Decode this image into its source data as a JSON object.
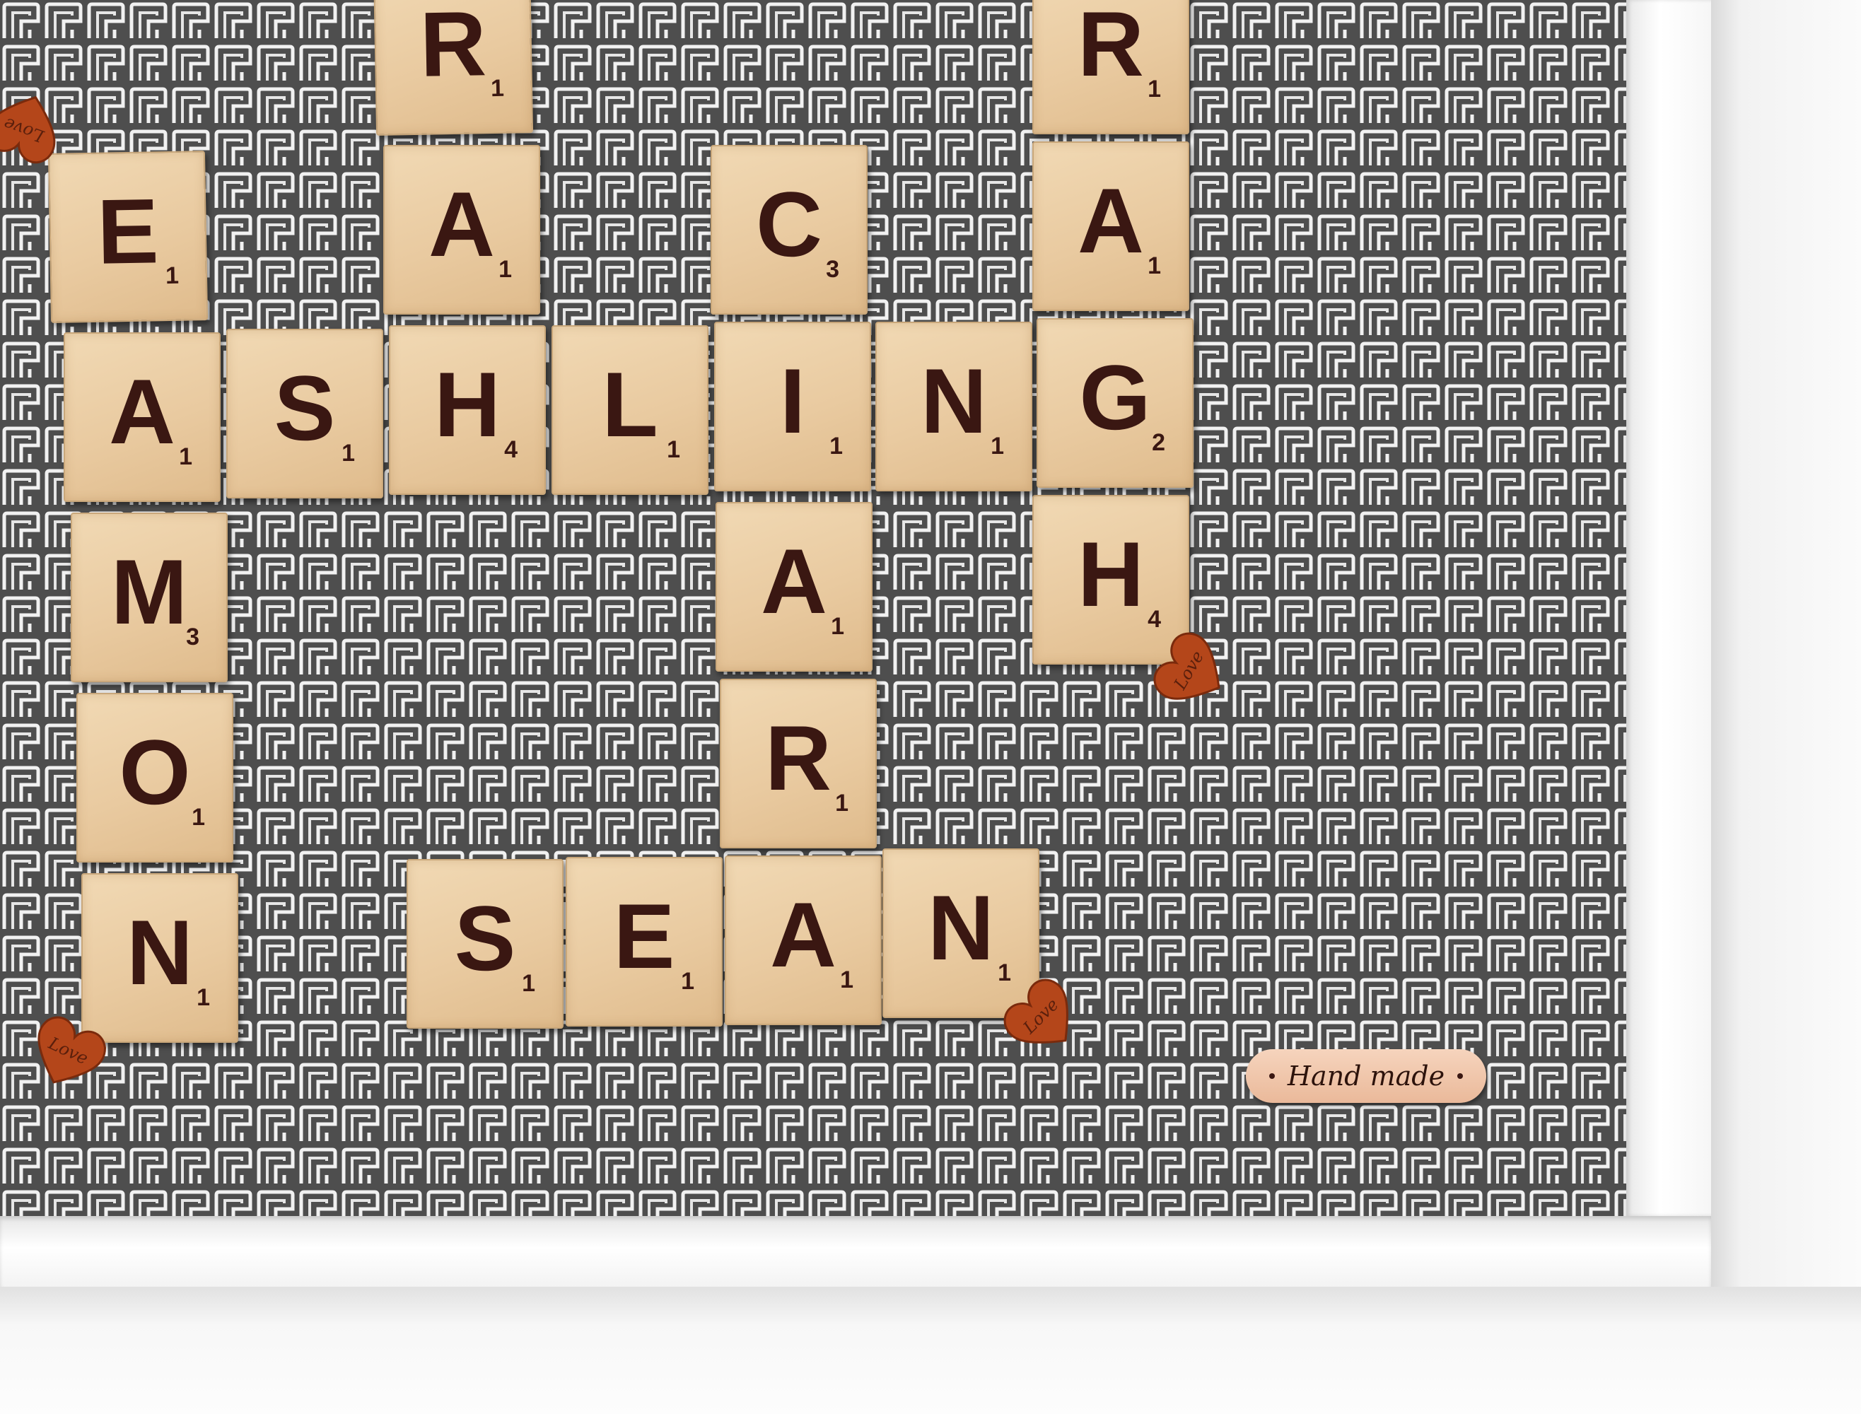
{
  "scene": {
    "description_colors": {
      "board_background": "#5a5a5a",
      "pattern_line": "#f0f0f0",
      "tile_wood": "#ebcda4",
      "tile_ink": "#3a1712",
      "heart_wood": "#b4461a",
      "frame": "#f7f7f7"
    }
  },
  "tiles": [
    {
      "letter": "R",
      "score": "1"
    },
    {
      "letter": "A",
      "score": "1"
    },
    {
      "letter": "R",
      "score": "1"
    },
    {
      "letter": "A",
      "score": "1"
    },
    {
      "letter": "H",
      "score": "4"
    },
    {
      "letter": "E",
      "score": "1"
    },
    {
      "letter": "A",
      "score": "1"
    },
    {
      "letter": "M",
      "score": "3"
    },
    {
      "letter": "O",
      "score": "1"
    },
    {
      "letter": "N",
      "score": "1"
    },
    {
      "letter": "S",
      "score": "1"
    },
    {
      "letter": "H",
      "score": "4"
    },
    {
      "letter": "L",
      "score": "1"
    },
    {
      "letter": "I",
      "score": "1"
    },
    {
      "letter": "N",
      "score": "1"
    },
    {
      "letter": "G",
      "score": "2"
    },
    {
      "letter": "C",
      "score": "3"
    },
    {
      "letter": "A",
      "score": "1"
    },
    {
      "letter": "R",
      "score": "1"
    },
    {
      "letter": "S",
      "score": "1"
    },
    {
      "letter": "E",
      "score": "1"
    },
    {
      "letter": "A",
      "score": "1"
    },
    {
      "letter": "N",
      "score": "1"
    }
  ],
  "hearts": [
    {
      "label": "Love",
      "icon": "heart-icon"
    },
    {
      "label": "Love",
      "icon": "heart-icon"
    },
    {
      "label": "Love",
      "icon": "heart-icon"
    },
    {
      "label": "Love",
      "icon": "heart-icon"
    }
  ],
  "badge": {
    "label": "Hand made"
  }
}
